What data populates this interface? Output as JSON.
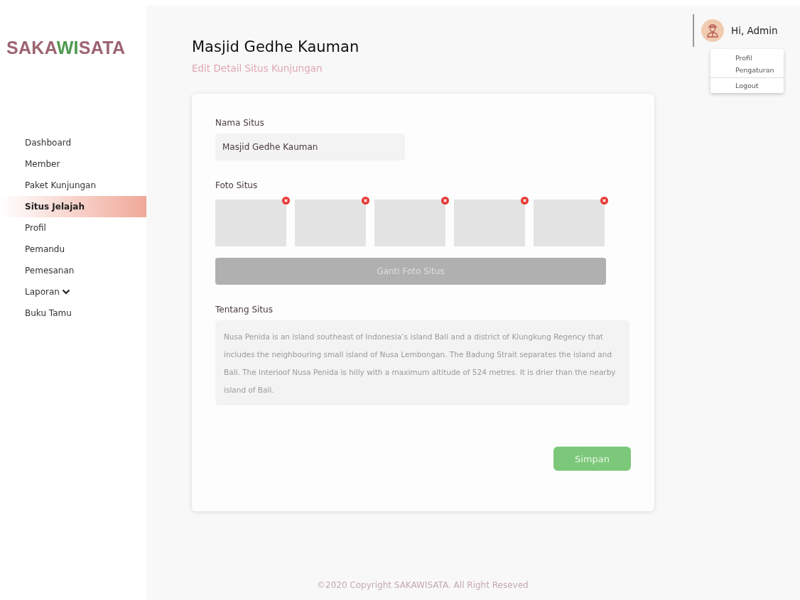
{
  "logo": [
    {
      "text": "SAKA",
      "color": "#9c6470"
    },
    {
      "text": "WI",
      "color": "#4f9a4f"
    },
    {
      "text": "SATA",
      "color": "#9c6470"
    }
  ],
  "sidebar": {
    "items": [
      {
        "label": "Dashboard",
        "selected": false
      },
      {
        "label": "Member",
        "selected": false
      },
      {
        "label": "Paket Kunjungan",
        "selected": false
      },
      {
        "label": "Situs Jelajah",
        "selected": true
      },
      {
        "label": "Profil",
        "selected": false
      },
      {
        "label": "Pemandu",
        "selected": false
      },
      {
        "label": "Pemesanan",
        "selected": false
      },
      {
        "label": "Laporan",
        "selected": false,
        "kind": "dropdown"
      },
      {
        "label": "Buku Tamu",
        "selected": false
      }
    ]
  },
  "header": {
    "title": "Masjid Gedhe Kauman",
    "subtitle": "Edit Detail Situs Kunjungan"
  },
  "user": {
    "greeting": "Hi, Admin",
    "menu": [
      "Profil",
      "Pengaturan",
      "Logout"
    ]
  },
  "form": {
    "name_label": "Nama Situs",
    "name_value": "Masjid Gedhe Kauman",
    "photos_label": "Foto Situs",
    "photos": [
      {
        "removable": true
      },
      {
        "removable": true
      },
      {
        "removable": true
      },
      {
        "removable": true
      },
      {
        "removable": true
      }
    ],
    "change_photo": {
      "label": "Ganti Foto Situs",
      "disabled": true
    },
    "about_label": "Tentang Situs",
    "about_placeholder": "Nusa Penida is an island southeast of Indonesia’s island Bali and a district of Klungkung Regency that includes the neighbouring small island of Nusa Lembongan. The Badung Strait separates the island and Bali. The interioof Nusa Penida is hilly with a maximum altitude of 524 metres. It is drier than the nearby island of Bali.",
    "save": "Simpan"
  },
  "footer": "©2020 Copyright SAKAWISATA. All Right Reseved"
}
